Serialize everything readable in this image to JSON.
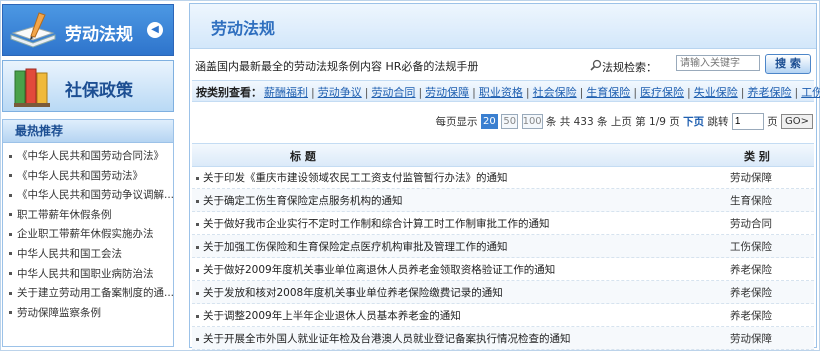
{
  "nav": {
    "laws_label": "劳动法规",
    "social_label": "社保政策"
  },
  "hot": {
    "title": "最热推荐",
    "items": [
      "《中华人民共和国劳动合同法》",
      "《中华人民共和国劳动法》",
      "《中华人民共和国劳动争议调解...",
      "职工带薪年休假条例",
      "企业职工带薪年休假实施办法",
      "中华人民共和国工会法",
      "中华人民共和国职业病防治法",
      "关于建立劳动用工备案制度的通...",
      "劳动保障监察条例"
    ]
  },
  "main": {
    "title": "劳动法规",
    "description": "涵盖国内最新最全的劳动法规条例内容  HR必备的法规手册",
    "search_label": "法规检索：",
    "search_placeholder": "请输入关键字",
    "search_button": "搜 索",
    "category_title": "按类别查看：",
    "categories": [
      "薪酬福利",
      "劳动争议",
      "劳动合同",
      "劳动保障",
      "职业资格",
      "社会保险",
      "生育保险",
      "医疗保险",
      "失业保险",
      "养老保险",
      "工伤保险"
    ]
  },
  "pager": {
    "per_page_label": "每页显示",
    "sizes": [
      "20",
      "50",
      "100"
    ],
    "unit": "条",
    "total_prefix": "共",
    "total": "433",
    "prev": "上页",
    "page_prefix": "第",
    "page_info": "1/9",
    "page_suffix": "页",
    "next": "下页",
    "jump_label": "跳转",
    "jump_value": "1",
    "go": "GO>"
  },
  "list": {
    "header_title": "标    题",
    "header_category": "类    别",
    "rows": [
      {
        "title": "关于印发《重庆市建设领域农民工工资支付监管暂行办法》的通知",
        "category": "劳动保障"
      },
      {
        "title": "关于确定工伤生育保险定点服务机构的通知",
        "category": "生育保险"
      },
      {
        "title": "关于做好我市企业实行不定时工作制和综合计算工时工作制审批工作的通知",
        "category": "劳动合同"
      },
      {
        "title": "关于加强工伤保险和生育保险定点医疗机构审批及管理工作的通知",
        "category": "工伤保险"
      },
      {
        "title": "关于做好2009年度机关事业单位离退休人员养老金领取资格验证工作的通知",
        "category": "养老保险"
      },
      {
        "title": "关于发放和核对2008年度机关事业单位养老保险缴费记录的通知",
        "category": "养老保险"
      },
      {
        "title": "关于调整2009年上半年企业退休人员基本养老金的通知",
        "category": "养老保险"
      },
      {
        "title": "关于开展全市外国人就业证年检及台港澳人员就业登记备案执行情况检查的通知",
        "category": "劳动保障"
      }
    ]
  }
}
